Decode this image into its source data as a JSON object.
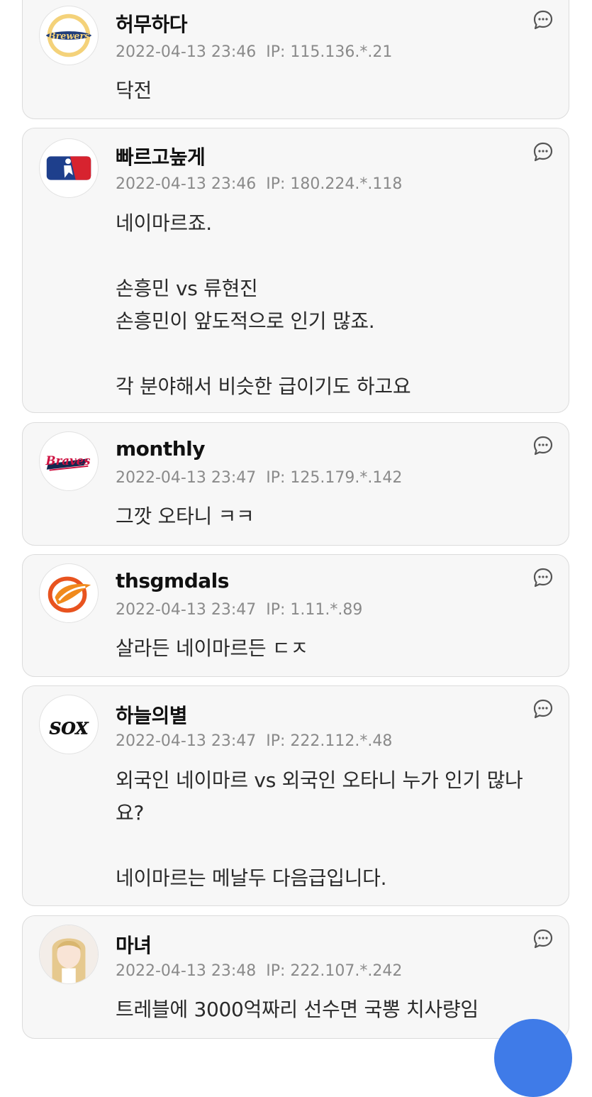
{
  "comments": [
    {
      "nickname": "허무하다",
      "datetime": "2022-04-13 23:46",
      "ip": "IP: 115.136.*.21",
      "text": "닥전",
      "avatar": "brewers-logo",
      "avatar_text": "Brewers"
    },
    {
      "nickname": "빠르고높게",
      "datetime": "2022-04-13 23:46",
      "ip": "IP: 180.224.*.118",
      "text": "네이마르죠.\n\n손흥민 vs 류현진\n손흥민이 앞도적으로 인기 많죠.\n\n각 분야해서 비슷한 급이기도 하고요",
      "avatar": "mlb-logo"
    },
    {
      "nickname": "monthly",
      "datetime": "2022-04-13 23:47",
      "ip": "IP: 125.179.*.142",
      "text": "그깟 오타니 ㅋㅋ",
      "avatar": "braves-logo",
      "avatar_text": "Braves"
    },
    {
      "nickname": "thsgmdals",
      "datetime": "2022-04-13 23:47",
      "ip": "IP: 1.11.*.89",
      "text": "살라든 네이마르든 ㄷㅈ",
      "avatar": "orange-ball-logo"
    },
    {
      "nickname": "하늘의별",
      "datetime": "2022-04-13 23:47",
      "ip": "IP: 222.112.*.48",
      "text": "외국인 네이마르 vs 외국인 오타니 누가 인기 많나요?\n\n네이마르는 메날두 다음급입니다.",
      "avatar": "white-sox-logo",
      "avatar_text": "SOX"
    },
    {
      "nickname": "마녀",
      "datetime": "2022-04-13 23:48",
      "ip": "IP: 222.107.*.242",
      "text": "트레블에 3000억짜리 선수면 국뽕 치사량임",
      "avatar": "anime-character-avatar"
    }
  ],
  "colors": {
    "card_bg": "#f7f7f7",
    "card_border": "#dcdcdc",
    "meta": "#8a8a8a",
    "fab": "#3f7be8"
  },
  "icons": {
    "reply": "comment-bubble-icon",
    "fab": "floating-action-button"
  }
}
